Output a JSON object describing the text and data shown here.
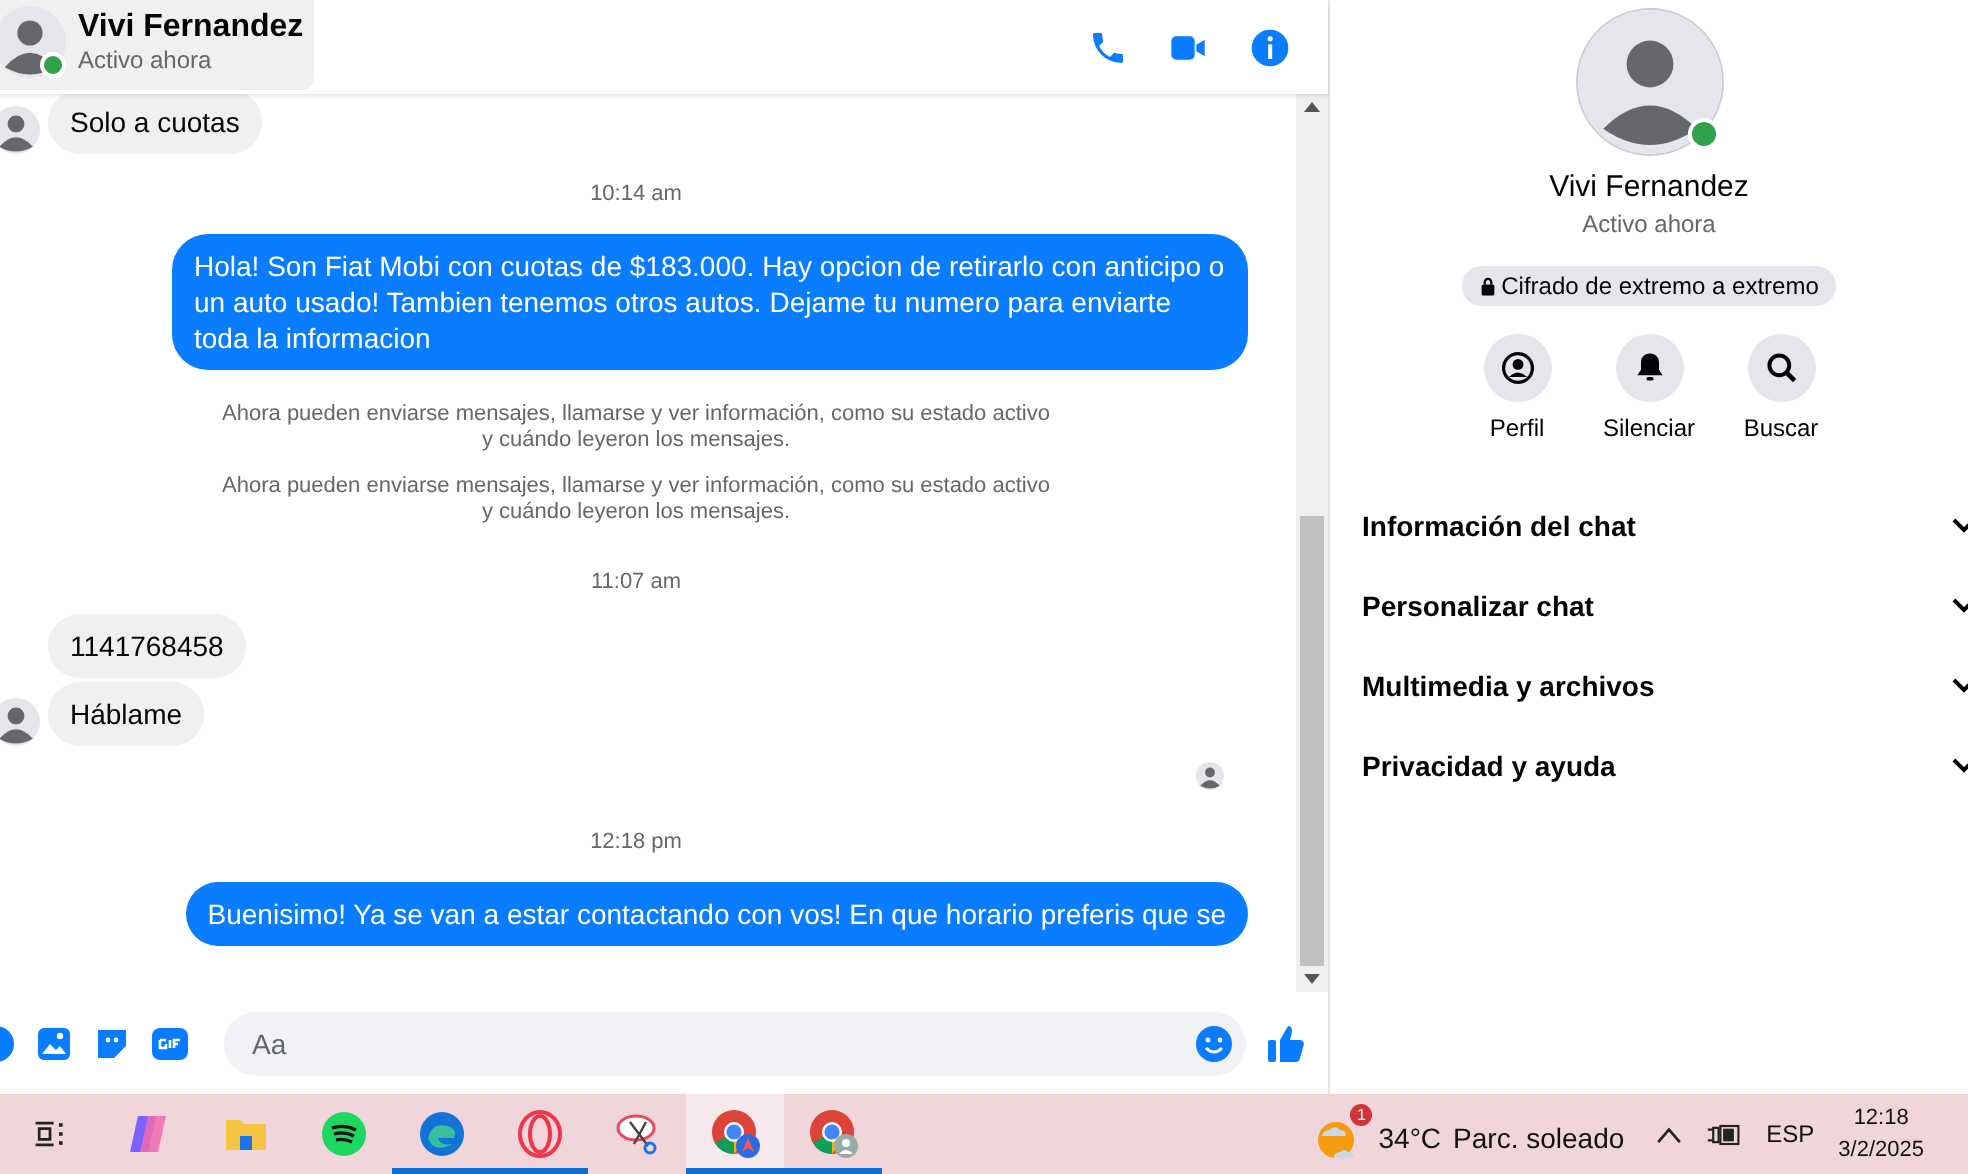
{
  "chat_header": {
    "name": "Vivi Fernandez",
    "status": "Activo ahora",
    "online": true
  },
  "messages": [
    {
      "kind": "incoming",
      "text": "Solo a cuotas",
      "avatar": true
    },
    {
      "kind": "time",
      "text": "10:14 am"
    },
    {
      "kind": "outgoing",
      "text": "Hola! Son Fiat Mobi con cuotas de $183.000. Hay opcion de retirarlo con anticipo o un auto usado! Tambien tenemos otros autos. Dejame tu numero para enviarte toda la informacion"
    },
    {
      "kind": "system",
      "text": "Ahora pueden enviarse mensajes, llamarse y ver información, como su estado activo y cuándo leyeron los mensajes."
    },
    {
      "kind": "system",
      "text": "Ahora pueden enviarse mensajes, llamarse y ver información, como su estado activo y cuándo leyeron los mensajes."
    },
    {
      "kind": "time",
      "text": "11:07 am"
    },
    {
      "kind": "incoming",
      "text": "1141768458",
      "avatar": false
    },
    {
      "kind": "incoming",
      "text": "Háblame",
      "avatar": true
    },
    {
      "kind": "seen"
    },
    {
      "kind": "time",
      "text": "12:18 pm"
    },
    {
      "kind": "outgoing",
      "text": "Buenisimo! Ya se van a estar contactando con vos! En que horario preferis que se"
    }
  ],
  "composer": {
    "placeholder": "Aa"
  },
  "profile": {
    "name": "Vivi Fernandez",
    "status": "Activo ahora",
    "online": true,
    "encryption": "Cifrado de extremo a extremo",
    "actions": [
      {
        "kind": "profile",
        "label": "Perfil"
      },
      {
        "kind": "mute",
        "label": "Silenciar"
      },
      {
        "kind": "search",
        "label": "Buscar"
      }
    ],
    "sections": [
      {
        "label": "Información del chat",
        "expanded": false
      },
      {
        "label": "Personalizar chat",
        "expanded": false
      },
      {
        "label": "Multimedia y archivos",
        "expanded": false
      },
      {
        "label": "Privacidad y ayuda",
        "expanded": false
      }
    ]
  },
  "taskbar": {
    "apps": [
      {
        "kind": "taskview",
        "open": false,
        "selected": false
      },
      {
        "kind": "copilot",
        "open": false,
        "selected": false
      },
      {
        "kind": "files",
        "open": false,
        "selected": false
      },
      {
        "kind": "spotify",
        "open": false,
        "selected": false
      },
      {
        "kind": "edge",
        "open": true,
        "selected": false
      },
      {
        "kind": "opera",
        "open": true,
        "selected": false
      },
      {
        "kind": "snip",
        "open": false,
        "selected": false
      },
      {
        "kind": "chrome",
        "open": true,
        "selected": true
      },
      {
        "kind": "chrome2",
        "open": true,
        "selected": false
      }
    ],
    "weather": {
      "badge": "1",
      "temp": "34°C",
      "desc": "Parc. soleado"
    },
    "language": "ESP",
    "time": "12:18",
    "date": "3/2/2025"
  }
}
